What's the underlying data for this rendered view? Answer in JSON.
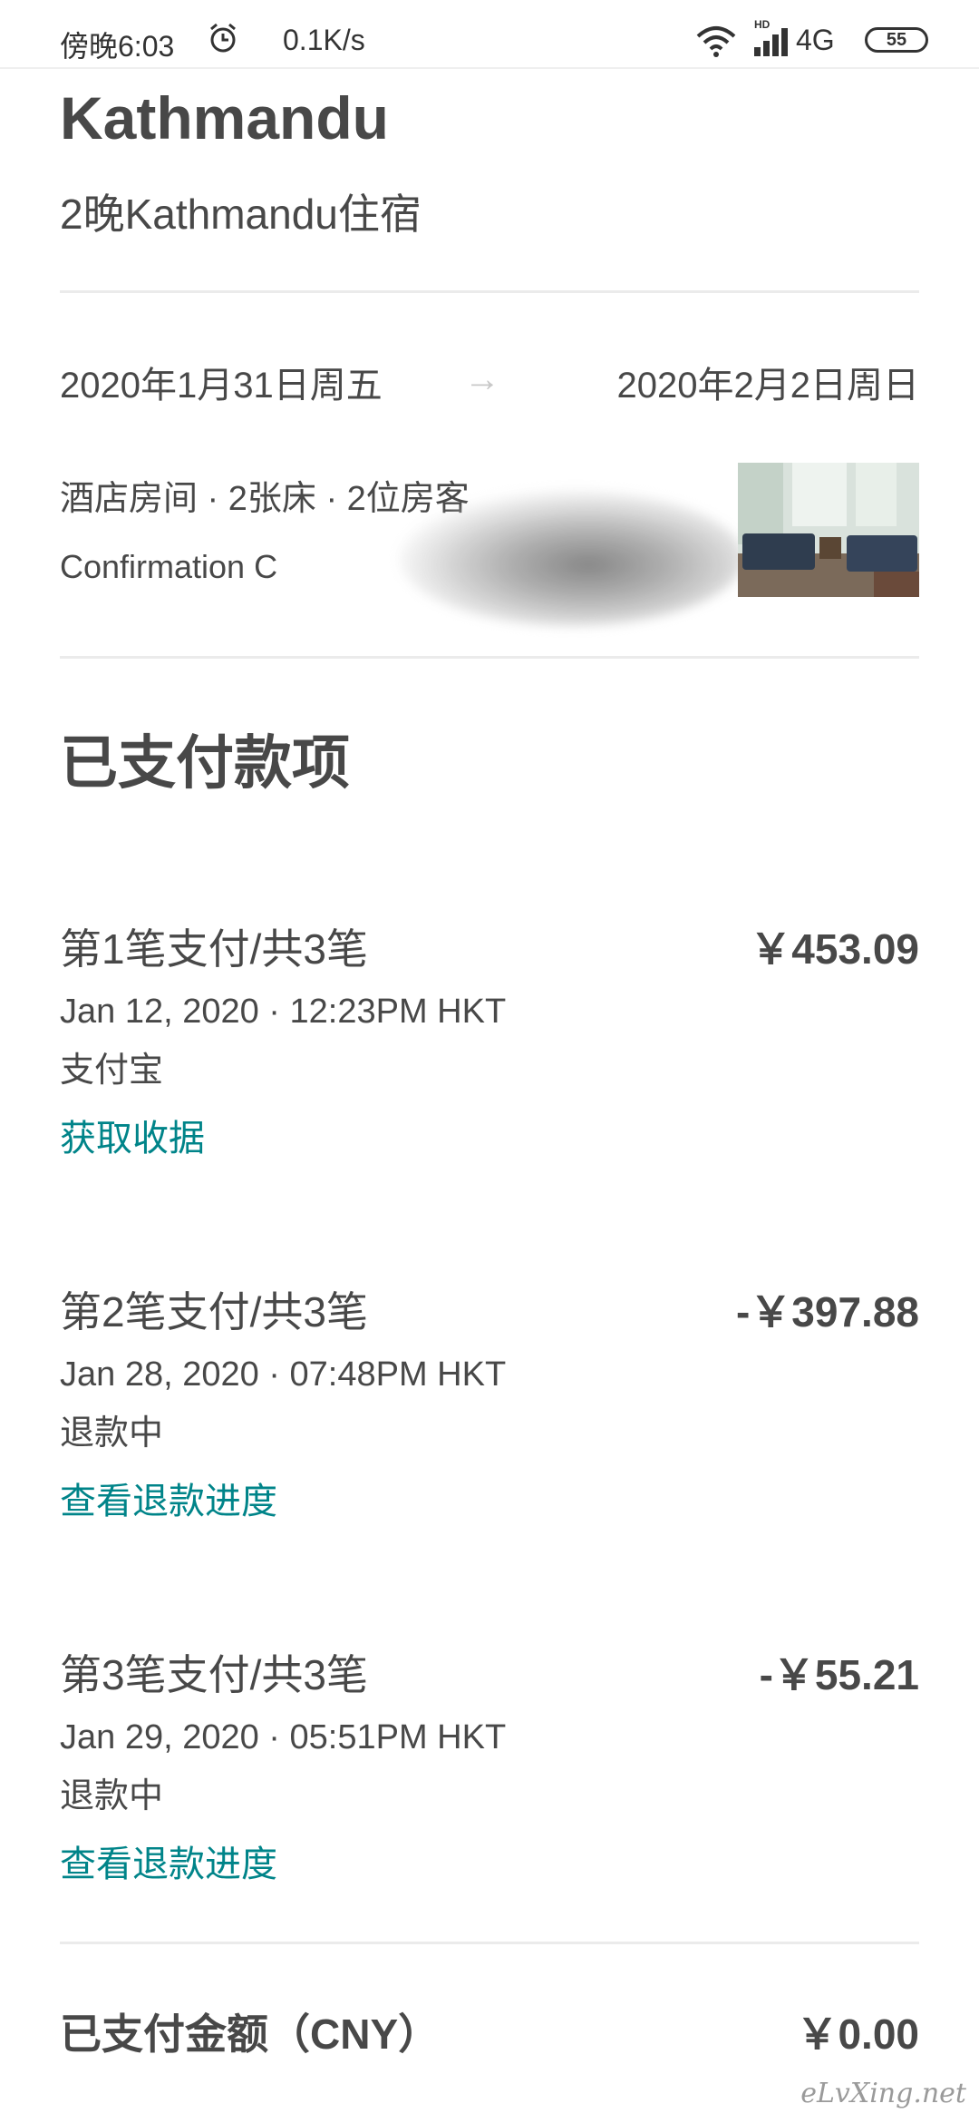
{
  "status_bar": {
    "time": "傍晚6:03",
    "net_speed": "0.1K/s",
    "hd_label": "HD",
    "network": "4G",
    "battery": "55",
    "icons": [
      "alarm-icon",
      "wifi-icon",
      "signal-icon"
    ]
  },
  "listing": {
    "title": "Kathmandu",
    "subtitle": "2晚Kathmandu住宿"
  },
  "dates": {
    "check_in": "2020年1月31日周五",
    "arrow": "→",
    "check_out": "2020年2月2日周日"
  },
  "room": {
    "summary": "酒店房间 · 2张床 · 2位房客",
    "confirmation": "Confirmation C"
  },
  "payments": {
    "section_title": "已支付款项",
    "items": [
      {
        "label": "第1笔支付/共3笔",
        "amount": "￥453.09",
        "time": "Jan 12, 2020 · 12:23PM HKT",
        "method": "支付宝",
        "link": "获取收据"
      },
      {
        "label": "第2笔支付/共3笔",
        "amount": "-￥397.88",
        "time": "Jan 28, 2020 · 07:48PM HKT",
        "method": "退款中",
        "link": "查看退款进度"
      },
      {
        "label": "第3笔支付/共3笔",
        "amount": "-￥55.21",
        "time": "Jan 29, 2020 · 05:51PM HKT",
        "method": "退款中",
        "link": "查看退款进度"
      }
    ]
  },
  "total": {
    "label": "已支付金额（CNY）",
    "amount": "￥0.00"
  },
  "watermark": "eLvXing.net",
  "colors": {
    "text": "#484848",
    "link": "#008489",
    "divider": "#ebebeb"
  }
}
